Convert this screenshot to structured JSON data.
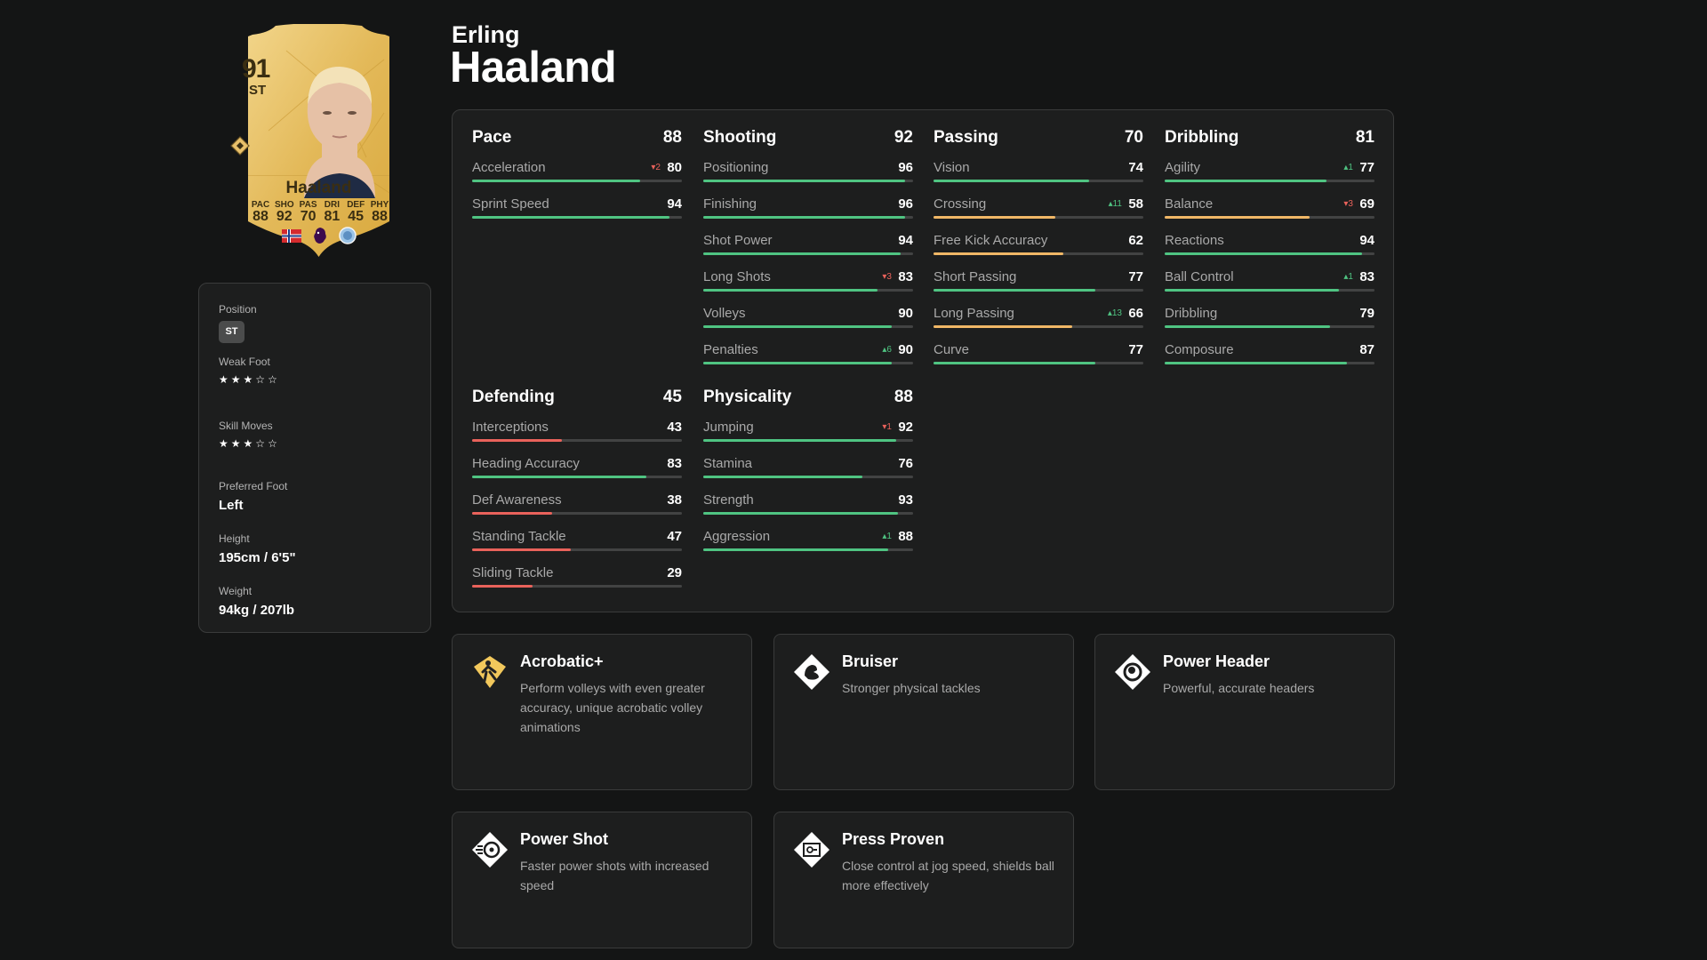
{
  "player": {
    "first_name": "Erling",
    "last_name": "Haaland"
  },
  "card": {
    "rating": "91",
    "position": "ST",
    "name": "Haaland",
    "stats": [
      {
        "key": "PAC",
        "value": "88"
      },
      {
        "key": "SHO",
        "value": "92"
      },
      {
        "key": "PAS",
        "value": "70"
      },
      {
        "key": "DRI",
        "value": "81"
      },
      {
        "key": "DEF",
        "value": "45"
      },
      {
        "key": "PHY",
        "value": "88"
      }
    ],
    "nation": "Norway",
    "league": "Premier League",
    "club": "Manchester City",
    "colors": {
      "gold": "#e8c064",
      "text": "#3a2e12"
    }
  },
  "info": {
    "position_label": "Position",
    "position_value": "ST",
    "weak_foot_label": "Weak Foot",
    "weak_foot_stars": 3,
    "skill_moves_label": "Skill Moves",
    "skill_moves_stars": 3,
    "stars_max": 5,
    "preferred_foot_label": "Preferred Foot",
    "preferred_foot_value": "Left",
    "height_label": "Height",
    "height_value": "195cm / 6'5\"",
    "weight_label": "Weight",
    "weight_value": "94kg / 207lb"
  },
  "colors": {
    "bar_high": "#4fc482",
    "bar_mid": "#f0b766",
    "bar_low": "#e9625b",
    "delta_up": "#4fc482",
    "delta_down": "#e9625b"
  },
  "categories": [
    {
      "name": "Pace",
      "value": "88",
      "stats": [
        {
          "name": "Acceleration",
          "value": 80,
          "delta": "-2"
        },
        {
          "name": "Sprint Speed",
          "value": 94,
          "delta": ""
        }
      ]
    },
    {
      "name": "Shooting",
      "value": "92",
      "stats": [
        {
          "name": "Positioning",
          "value": 96,
          "delta": ""
        },
        {
          "name": "Finishing",
          "value": 96,
          "delta": ""
        },
        {
          "name": "Shot Power",
          "value": 94,
          "delta": ""
        },
        {
          "name": "Long Shots",
          "value": 83,
          "delta": "-3"
        },
        {
          "name": "Volleys",
          "value": 90,
          "delta": ""
        },
        {
          "name": "Penalties",
          "value": 90,
          "delta": "+6"
        }
      ]
    },
    {
      "name": "Passing",
      "value": "70",
      "stats": [
        {
          "name": "Vision",
          "value": 74,
          "delta": ""
        },
        {
          "name": "Crossing",
          "value": 58,
          "delta": "+11"
        },
        {
          "name": "Free Kick Accuracy",
          "value": 62,
          "delta": ""
        },
        {
          "name": "Short Passing",
          "value": 77,
          "delta": ""
        },
        {
          "name": "Long Passing",
          "value": 66,
          "delta": "+13"
        },
        {
          "name": "Curve",
          "value": 77,
          "delta": ""
        }
      ]
    },
    {
      "name": "Dribbling",
      "value": "81",
      "stats": [
        {
          "name": "Agility",
          "value": 77,
          "delta": "+1"
        },
        {
          "name": "Balance",
          "value": 69,
          "delta": "-3"
        },
        {
          "name": "Reactions",
          "value": 94,
          "delta": ""
        },
        {
          "name": "Ball Control",
          "value": 83,
          "delta": "+1"
        },
        {
          "name": "Dribbling",
          "value": 79,
          "delta": ""
        },
        {
          "name": "Composure",
          "value": 87,
          "delta": ""
        }
      ]
    },
    {
      "name": "Defending",
      "value": "45",
      "stats": [
        {
          "name": "Interceptions",
          "value": 43,
          "delta": ""
        },
        {
          "name": "Heading Accuracy",
          "value": 83,
          "delta": ""
        },
        {
          "name": "Def Awareness",
          "value": 38,
          "delta": ""
        },
        {
          "name": "Standing Tackle",
          "value": 47,
          "delta": ""
        },
        {
          "name": "Sliding Tackle",
          "value": 29,
          "delta": ""
        }
      ]
    },
    {
      "name": "Physicality",
      "value": "88",
      "stats": [
        {
          "name": "Jumping",
          "value": 92,
          "delta": "-1"
        },
        {
          "name": "Stamina",
          "value": 76,
          "delta": ""
        },
        {
          "name": "Strength",
          "value": 93,
          "delta": ""
        },
        {
          "name": "Aggression",
          "value": 88,
          "delta": "+1"
        }
      ]
    }
  ],
  "playstyles": [
    {
      "title": "Acrobatic+",
      "desc": "Perform volleys with even greater accuracy, unique acrobatic volley animations",
      "icon": "acrobatic-icon",
      "plus": true
    },
    {
      "title": "Bruiser",
      "desc": "Stronger physical tackles",
      "icon": "bruiser-icon",
      "plus": false
    },
    {
      "title": "Power Header",
      "desc": "Powerful, accurate headers",
      "icon": "power-header-icon",
      "plus": false
    },
    {
      "title": "Power Shot",
      "desc": "Faster power shots with increased speed",
      "icon": "power-shot-icon",
      "plus": false
    },
    {
      "title": "Press Proven",
      "desc": "Close control at jog speed, shields ball more effectively",
      "icon": "press-proven-icon",
      "plus": false
    }
  ]
}
